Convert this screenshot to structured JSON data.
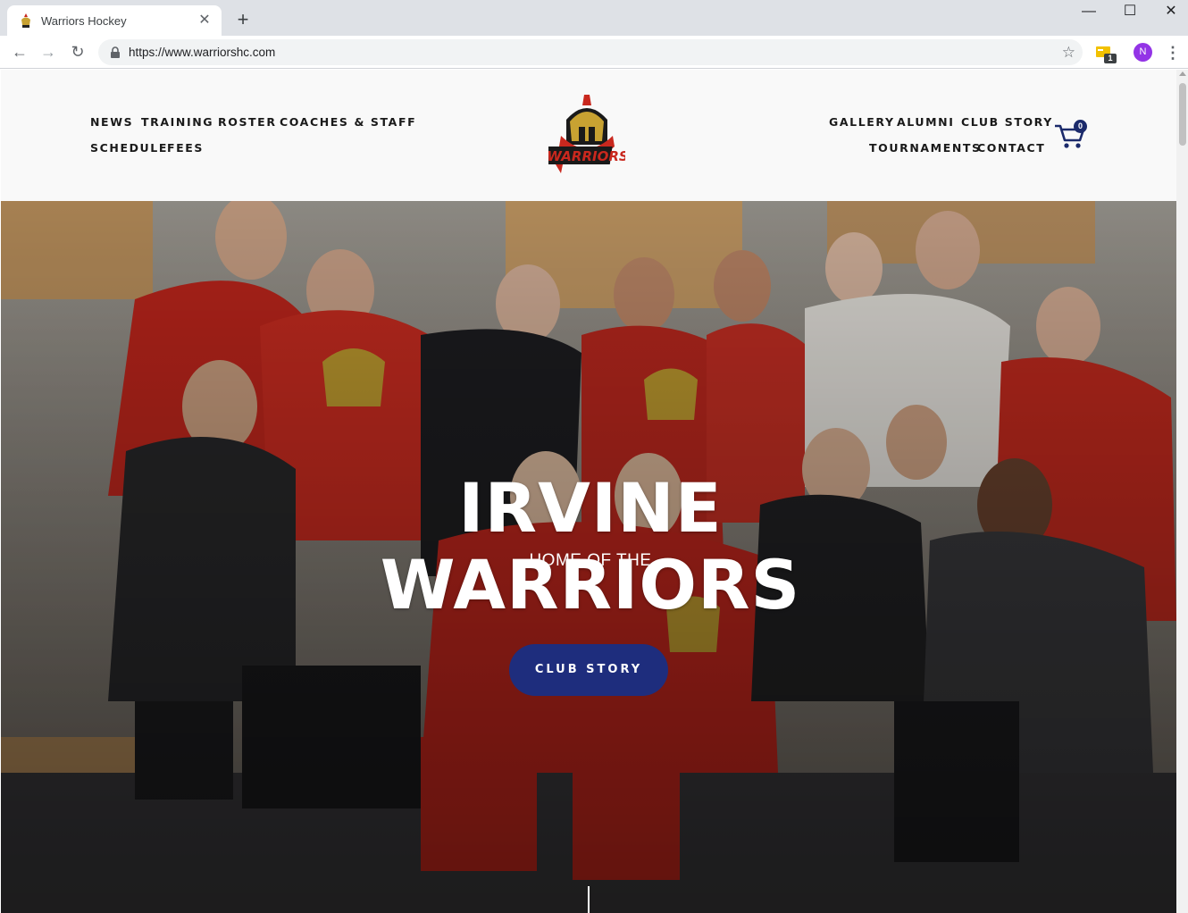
{
  "browser": {
    "tab_title": "Warriors Hockey",
    "tab_close": "✕",
    "new_tab": "+",
    "url": "https://www.warriorshc.com",
    "window_controls": {
      "minimize": "—",
      "maximize": "☐",
      "close": "✕"
    },
    "extension_badge": "1",
    "profile_initial": "N",
    "menu": "⋮",
    "back": "←",
    "forward": "→",
    "reload": "↻",
    "bookmark": "☆"
  },
  "header": {
    "nav_left": [
      "NEWS",
      "TRAINING",
      "ROSTER",
      "COACHES & STAFF",
      "SCHEDULE",
      "FEES"
    ],
    "nav_right": [
      "GALLERY",
      "ALUMNI",
      "CLUB STORY",
      "TOURNAMENTS",
      "CONTACT"
    ],
    "logo_text": "WARRIORS",
    "cart_count": "0"
  },
  "hero": {
    "kicker": "HOME OF THE",
    "title_line1": "IRVINE",
    "title_line2": "WARRIORS",
    "button_label": "CLUB STORY"
  },
  "colors": {
    "brand_navy": "#1e2d7d",
    "jersey_red": "#c9281e",
    "logo_gold": "#c8a232"
  }
}
